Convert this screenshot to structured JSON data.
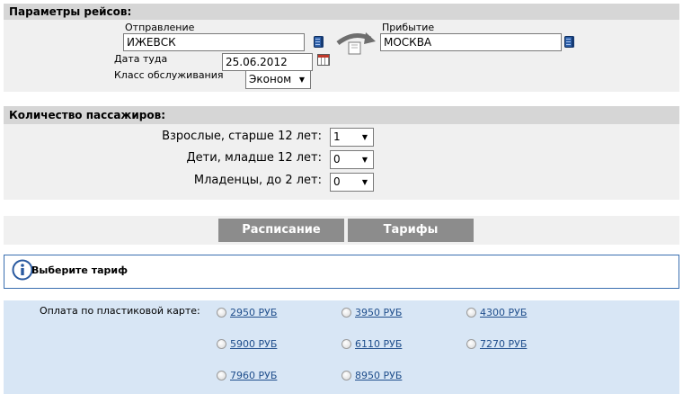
{
  "flight_params": {
    "header": "Параметры рейсов:",
    "departure_label": "Отправление",
    "departure_value": "ИЖЕВСК",
    "arrival_label": "Прибытие",
    "arrival_value": "МОСКВА",
    "date_label": "Дата туда",
    "date_value": "25.06.2012",
    "class_label": "Класс обслуживания",
    "class_value": "Эконом"
  },
  "passengers": {
    "header": "Количество пассажиров:",
    "adults_label": "Взрослые, старше 12 лет:",
    "adults_value": "1",
    "children_label": "Дети, младше 12 лет:",
    "children_value": "0",
    "infants_label": "Младенцы, до 2 лет:",
    "infants_value": "0"
  },
  "buttons": {
    "schedule": "Расписание",
    "fares": "Тарифы"
  },
  "info": {
    "text": "Выберите тариф"
  },
  "payment": {
    "label": "Оплата по пластиковой карте:",
    "fares": [
      "2950 РУБ",
      "3950 РУБ",
      "4300 РУБ",
      "5900 РУБ",
      "6110 РУБ",
      "7270 РУБ",
      "7960 РУБ",
      "8950 РУБ"
    ]
  },
  "colors": {
    "section_header": "#d6d6d6",
    "section_body": "#f0f0f0",
    "button": "#8c8c8c",
    "fare_panel": "#d8e6f5",
    "link": "#1f4e8c",
    "info_border": "#3a6fb0"
  }
}
